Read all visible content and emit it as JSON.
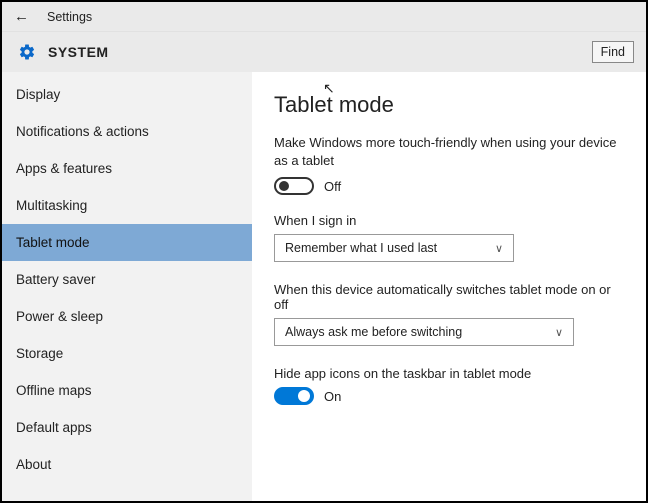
{
  "titlebar": {
    "label": "Settings"
  },
  "header": {
    "title": "SYSTEM",
    "find_label": "Find"
  },
  "sidebar": {
    "items": [
      {
        "label": "Display"
      },
      {
        "label": "Notifications & actions"
      },
      {
        "label": "Apps & features"
      },
      {
        "label": "Multitasking"
      },
      {
        "label": "Tablet mode"
      },
      {
        "label": "Battery saver"
      },
      {
        "label": "Power & sleep"
      },
      {
        "label": "Storage"
      },
      {
        "label": "Offline maps"
      },
      {
        "label": "Default apps"
      },
      {
        "label": "About"
      }
    ],
    "selected_index": 4
  },
  "main": {
    "heading": "Tablet mode",
    "description": "Make Windows more touch-friendly when using your device as a tablet",
    "toggle1": {
      "state": "off",
      "label": "Off"
    },
    "signin_label": "When I sign in",
    "signin_value": "Remember what I used last",
    "auto_label": "When this device automatically switches tablet mode on or off",
    "auto_value": "Always ask me before switching",
    "hide_label": "Hide app icons on the taskbar in tablet mode",
    "toggle2": {
      "state": "on",
      "label": "On"
    }
  }
}
